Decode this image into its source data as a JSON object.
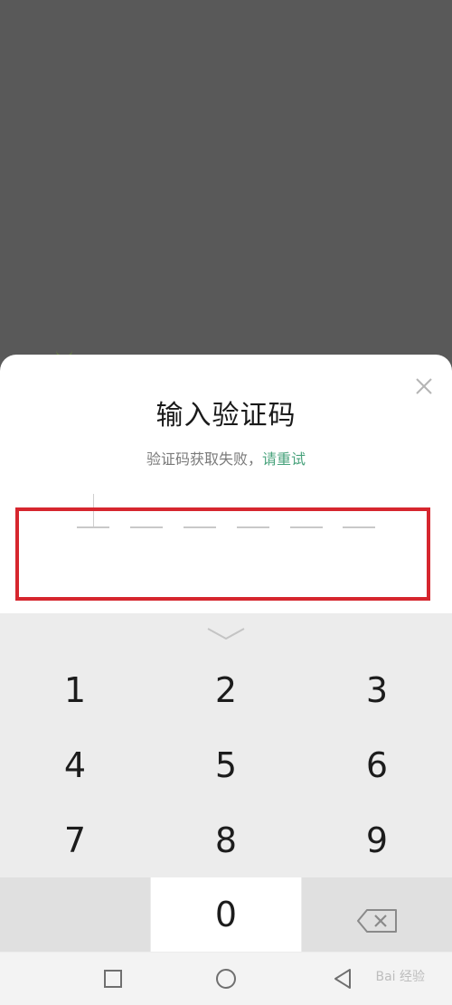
{
  "dialog": {
    "title": "输入验证码",
    "subtitle_prefix": "验证码获取失败，",
    "retry_label": "请重试",
    "code_slots": [
      "",
      "",
      "",
      "",
      "",
      ""
    ],
    "accent_color": "#4aa37d",
    "highlight_color": "#d6262e"
  },
  "keypad": {
    "keys": [
      "1",
      "2",
      "3",
      "4",
      "5",
      "6",
      "7",
      "8",
      "9",
      "0"
    ]
  },
  "watermark": "Bai 经验"
}
